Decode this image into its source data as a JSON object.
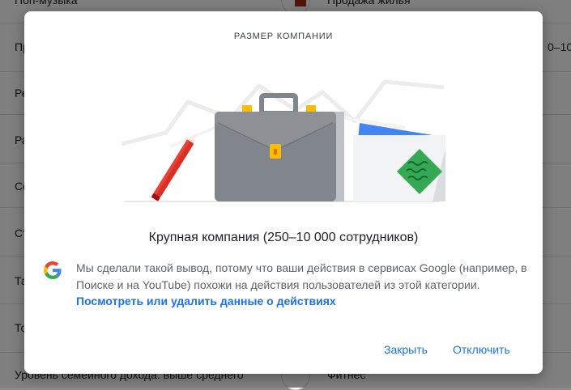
{
  "background": {
    "left_items": [
      "Поп-музыка",
      "Пр",
      "Ре",
      "Ра",
      "Се",
      "Ст",
      "Та",
      "То",
      "Уровень семейного дохода: выше среднего"
    ],
    "right_items": [
      "Продажа жилья",
      "0–10...",
      "Фитнес"
    ]
  },
  "dialog": {
    "title": "РАЗМЕР КОМПАНИИ",
    "category": "Крупная компания (250–10 000 сотрудников)",
    "explanation": "Мы сделали такой вывод, потому что ваши действия в сервисах Google (например, в Поиске и на YouTube) похожи на действия пользователей из этой категории.",
    "link_label": "Посмотреть или удалить данные о действиях",
    "close_label": "Закрыть",
    "disable_label": "Отключить"
  },
  "icons": {
    "google": "google-g-icon",
    "illustration": "briefcase-illustration"
  },
  "colors": {
    "accent": "#1a73e8",
    "scrim": "rgba(0,0,0,0.5)",
    "briefcase": "#80868b",
    "clasp": "#fbbc04",
    "pencil": "#d93025",
    "folder": "#4285f4",
    "badge": "#34a853"
  }
}
